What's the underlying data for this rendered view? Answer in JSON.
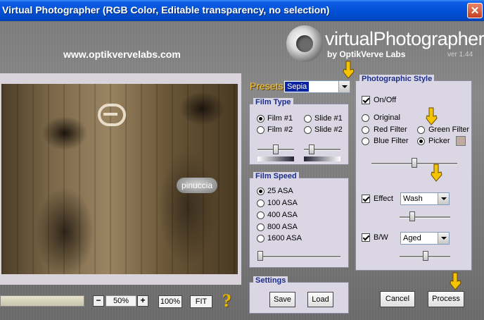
{
  "window": {
    "title": "Virtual Photographer (RGB Color, Editable transparency, no selection)",
    "close_glyph": "✕"
  },
  "header": {
    "site_url": "www.optikvervelabs.com",
    "logo_text": "virtualPhotographer",
    "logo_by": "by OptikVerve Labs",
    "version": "ver 1.44"
  },
  "preview": {
    "watermark": "pinuccia"
  },
  "toolbar": {
    "zoom_minus": "−",
    "zoom_value": "50%",
    "zoom_plus": "+",
    "zoom_100": "100%",
    "zoom_fit": "FIT",
    "help": "?"
  },
  "presets": {
    "label": "Presets",
    "selected": "Sepia"
  },
  "film_type": {
    "title": "Film Type",
    "options": [
      "Film #1",
      "Film #2",
      "Slide #1",
      "Slide #2"
    ],
    "selected": "Film #1",
    "slider1_level": 0.45,
    "slider2_level": 0.2
  },
  "film_speed": {
    "title": "Film Speed",
    "options": [
      "25 ASA",
      "100 ASA",
      "400 ASA",
      "800 ASA",
      "1600 ASA"
    ],
    "selected": "25 ASA",
    "slider_level": 0.0
  },
  "settings": {
    "title": "Settings",
    "save": "Save",
    "load": "Load"
  },
  "photographic_style": {
    "title": "Photographic Style",
    "onoff_label": "On/Off",
    "onoff_checked": true,
    "styles": [
      "Original",
      "Red Filter",
      "Blue Filter",
      "Green Filter",
      "Picker"
    ],
    "selected": "Picker",
    "picker_color": "#bfaaa0",
    "main_slider_level": 0.5,
    "effect_label": "Effect",
    "effect_checked": true,
    "effect_value": "Wash",
    "effect_slider_level": 0.2,
    "bw_label": "B/W",
    "bw_checked": true,
    "bw_value": "Aged",
    "bw_slider_level": 0.5
  },
  "actions": {
    "cancel": "Cancel",
    "process": "Process"
  },
  "colors": {
    "title_bar": "#0351d7",
    "panel_bg": "#dad6e3",
    "panel_title": "#1a2d8a",
    "hand_pointer": "#f5c400"
  }
}
